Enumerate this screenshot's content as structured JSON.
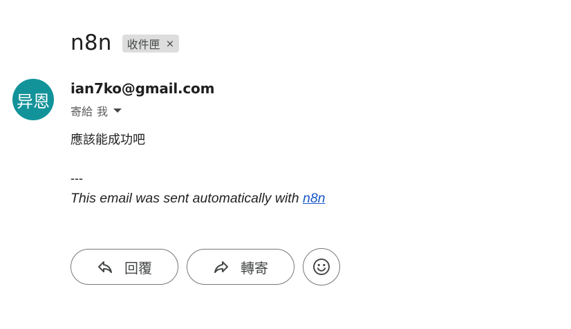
{
  "email": {
    "subject": "n8n",
    "label_chip": {
      "text": "收件匣",
      "close": "×"
    },
    "avatar_text": "异恩",
    "sender": "ian7ko@gmail.com",
    "recipient_prefix": "寄給",
    "recipient": "我",
    "body": "應該能成功吧",
    "separator": "---",
    "footer_text": "This email was sent automatically with ",
    "footer_link": "n8n"
  },
  "actions": {
    "reply_label": "回覆",
    "forward_label": "轉寄"
  },
  "icons": {
    "reply": "reply-icon",
    "forward": "forward-icon",
    "emoji": "emoji-icon",
    "caret": "chevron-down-icon",
    "close": "close-icon"
  },
  "colors": {
    "avatar_bg": "#12939a",
    "link": "#1a57c8",
    "chip_bg": "#dddddd",
    "button_border": "#747775"
  }
}
